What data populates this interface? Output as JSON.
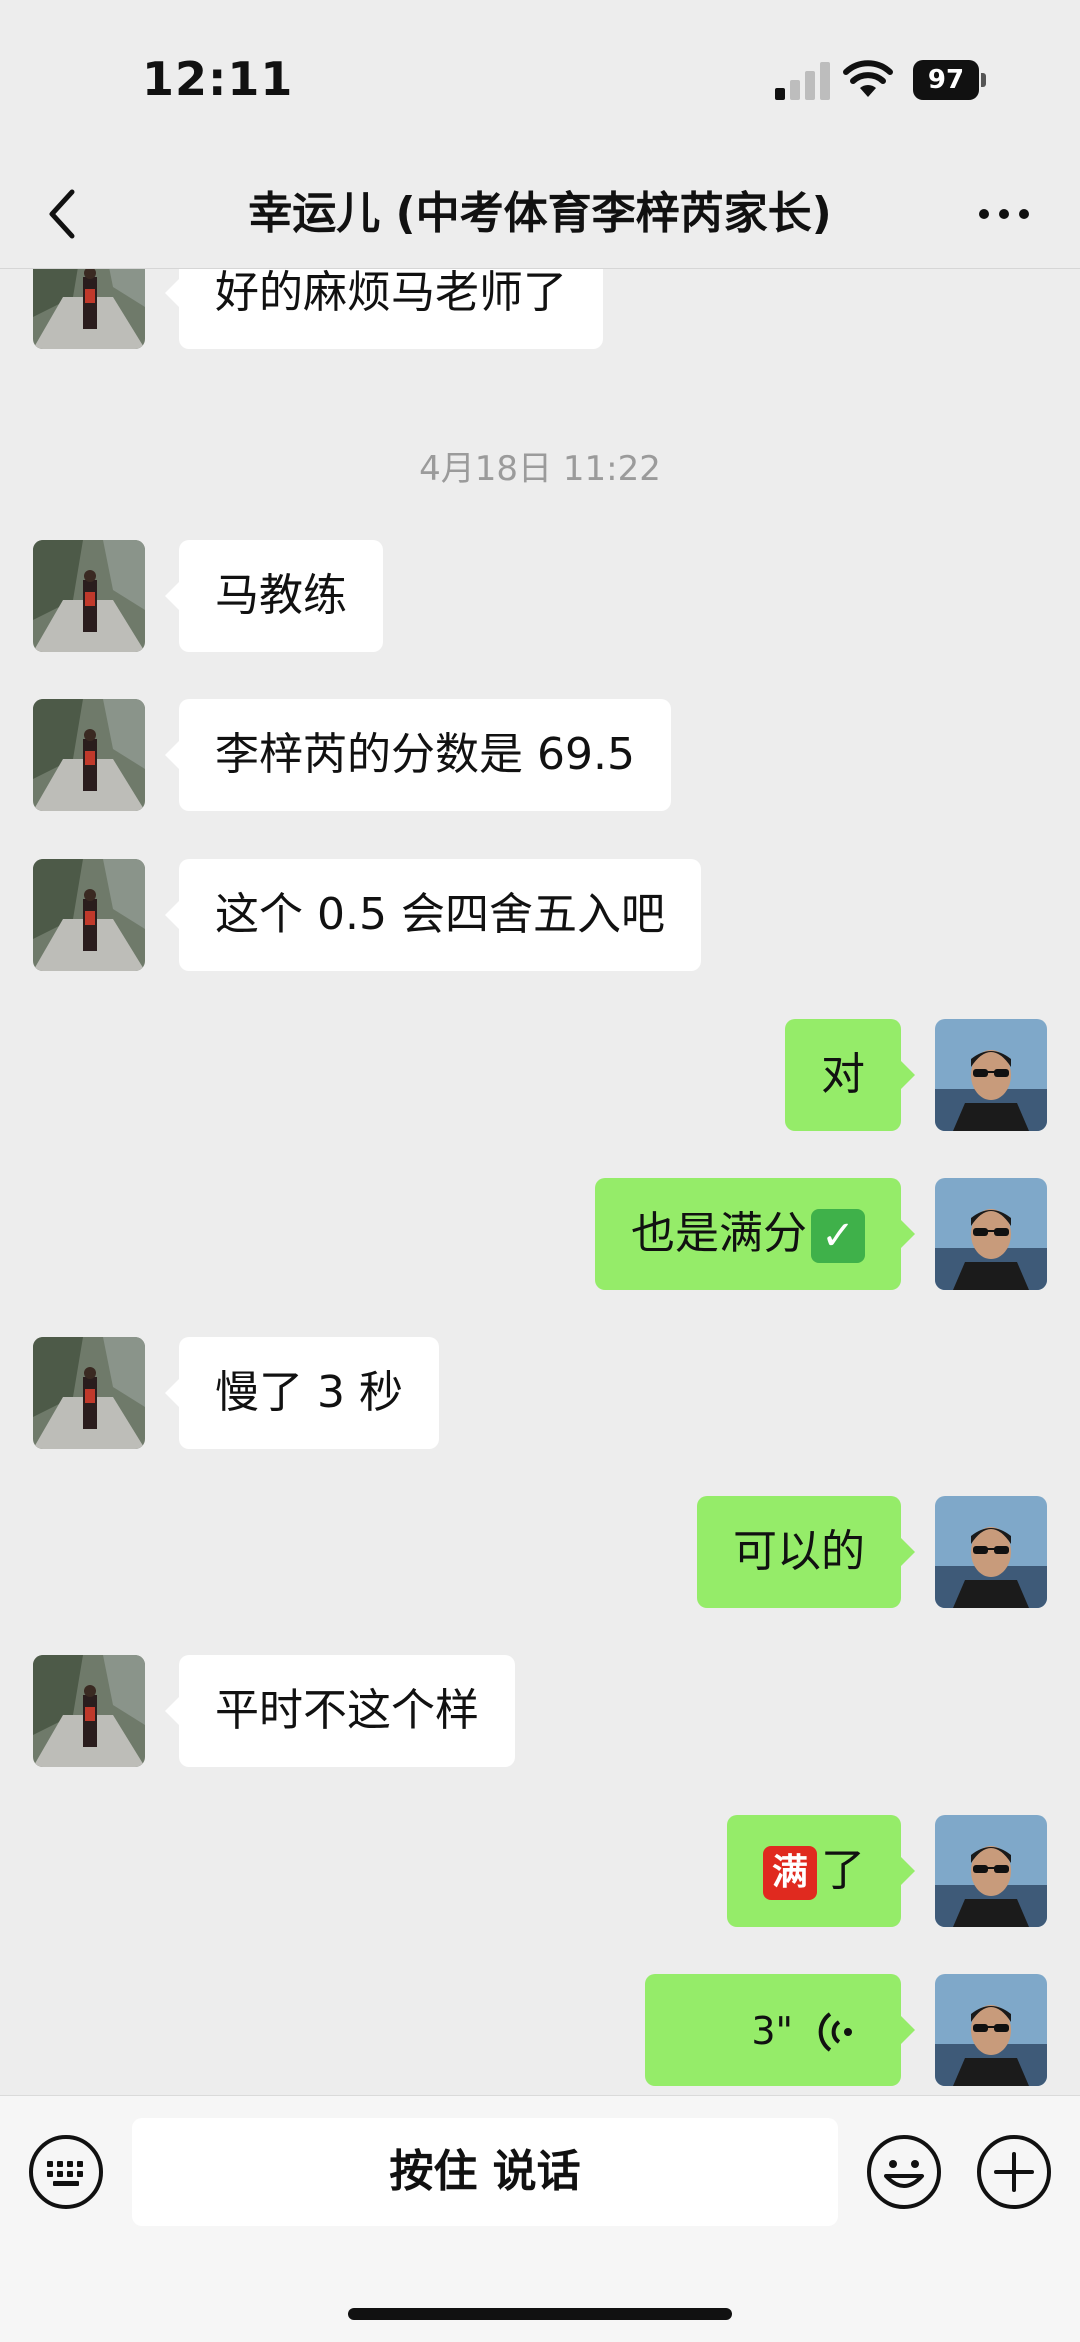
{
  "status_bar": {
    "time": "12:11",
    "battery": "97"
  },
  "nav": {
    "title": "幸运儿 (中考体育李梓芮家长)"
  },
  "chat": {
    "messages": [
      {
        "side": "left",
        "text": "好的麻烦马老师了"
      },
      {
        "timestamp": "4月18日 11:22"
      },
      {
        "side": "left",
        "text": "马教练"
      },
      {
        "side": "left",
        "text": "李梓芮的分数是 69.5"
      },
      {
        "side": "left",
        "text": "这个 0.5 会四舍五入吧"
      },
      {
        "side": "right",
        "text": "对"
      },
      {
        "side": "right",
        "text": "也是满分",
        "emoji": "✓"
      },
      {
        "side": "left",
        "text": "慢了 3 秒"
      },
      {
        "side": "right",
        "text": "可以的"
      },
      {
        "side": "left",
        "text": "平时不这个样"
      },
      {
        "side": "right",
        "emoji": "满",
        "text": "了"
      },
      {
        "side": "right",
        "voice_duration": "3\""
      }
    ]
  },
  "input_bar": {
    "hold_to_talk": "按住 说话"
  },
  "colors": {
    "background": "#ededed",
    "self_bubble": "#95ec69",
    "other_bubble": "#ffffff"
  }
}
